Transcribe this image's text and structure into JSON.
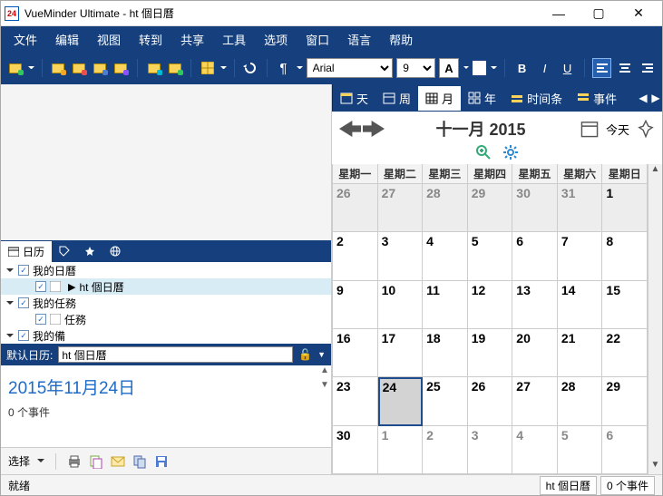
{
  "window": {
    "app_icon_text": "24",
    "title": "VueMinder Ultimate - ht 個日曆"
  },
  "menu": [
    "文件",
    "编辑",
    "视图",
    "转到",
    "共享",
    "工具",
    "选项",
    "窗口",
    "语言",
    "帮助"
  ],
  "toolbar": {
    "font_name": "Arial",
    "font_size": "9",
    "font_color_label": "A",
    "bold": "B",
    "italic": "I",
    "underline": "U"
  },
  "sidebar": {
    "tabs": {
      "calendar": "日历"
    },
    "tree": {
      "my_calendars": "我的日曆",
      "cal1": "ht 個日曆",
      "my_tasks": "我的任務",
      "task1": "任務",
      "my_notes_cut": "我的備"
    },
    "default_label": "默认日历:",
    "default_value": "ht 個日曆"
  },
  "selected": {
    "date_text": "2015年11月24日",
    "count_text": "0 个事件"
  },
  "choice": {
    "label": "选择"
  },
  "viewtabs": {
    "day": "天",
    "week": "周",
    "month": "月",
    "year": "年",
    "timeline": "时间条",
    "events": "事件"
  },
  "month": {
    "title": "十一月 2015",
    "today": "今天",
    "dow": [
      "星期一",
      "星期二",
      "星期三",
      "星期四",
      "星期五",
      "星期六",
      "星期日"
    ],
    "cells": [
      {
        "n": "26",
        "o": true
      },
      {
        "n": "27",
        "o": true
      },
      {
        "n": "28",
        "o": true
      },
      {
        "n": "29",
        "o": true
      },
      {
        "n": "30",
        "o": true
      },
      {
        "n": "31",
        "o": true
      },
      {
        "n": "1"
      },
      {
        "n": "2"
      },
      {
        "n": "3"
      },
      {
        "n": "4"
      },
      {
        "n": "5"
      },
      {
        "n": "6"
      },
      {
        "n": "7"
      },
      {
        "n": "8"
      },
      {
        "n": "9"
      },
      {
        "n": "10"
      },
      {
        "n": "11"
      },
      {
        "n": "12"
      },
      {
        "n": "13"
      },
      {
        "n": "14"
      },
      {
        "n": "15"
      },
      {
        "n": "16"
      },
      {
        "n": "17"
      },
      {
        "n": "18"
      },
      {
        "n": "19"
      },
      {
        "n": "20"
      },
      {
        "n": "21"
      },
      {
        "n": "22"
      },
      {
        "n": "23"
      },
      {
        "n": "24",
        "sel": true
      },
      {
        "n": "25"
      },
      {
        "n": "26"
      },
      {
        "n": "27"
      },
      {
        "n": "28"
      },
      {
        "n": "29"
      },
      {
        "n": "30"
      },
      {
        "n": "1",
        "o": true
      },
      {
        "n": "2",
        "o": true
      },
      {
        "n": "3",
        "o": true
      },
      {
        "n": "4",
        "o": true
      },
      {
        "n": "5",
        "o": true
      },
      {
        "n": "6",
        "o": true
      }
    ]
  },
  "status": {
    "ready": "就绪",
    "cal_name": "ht 個日曆",
    "count": "0 个事件"
  }
}
